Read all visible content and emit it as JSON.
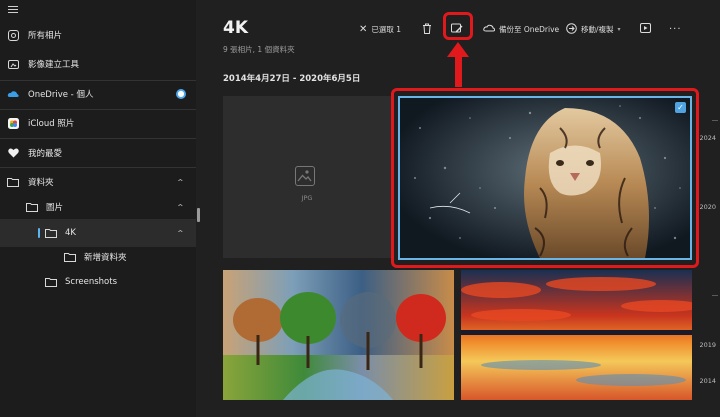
{
  "sidebar": {
    "items": [
      {
        "label": "所有相片",
        "icon": "photos-icon"
      },
      {
        "label": "影像建立工具",
        "icon": "creator-icon"
      },
      {
        "label": "OneDrive - 個人",
        "icon": "cloud-icon"
      },
      {
        "label": "iCloud 照片",
        "icon": "icloud-icon"
      },
      {
        "label": "我的最愛",
        "icon": "heart-icon"
      },
      {
        "label": "資料夾",
        "icon": "folder-icon"
      },
      {
        "label": "圖片",
        "icon": "folder-icon"
      },
      {
        "label": "4K",
        "icon": "folder-icon"
      },
      {
        "label": "新增資料夾",
        "icon": "folder-icon"
      },
      {
        "label": "Screenshots",
        "icon": "folder-icon"
      }
    ]
  },
  "main": {
    "title": "4K",
    "subtitle": "9 張相片, 1 個資料夾",
    "date_range": "2014年4月27日 - 2020年6月5日",
    "jpg_label": "JPG"
  },
  "toolbar": {
    "selected_label": "已選取 1",
    "backup_label": "備份至 OneDrive",
    "move_copy_label": "移動/複製"
  },
  "timeline": [
    "2024",
    "2020",
    "2019",
    "2014"
  ],
  "colors": {
    "accent": "#4fa3e0",
    "annotation": "#e0191c",
    "background": "#202020",
    "sidebar": "#1c1c1c"
  }
}
